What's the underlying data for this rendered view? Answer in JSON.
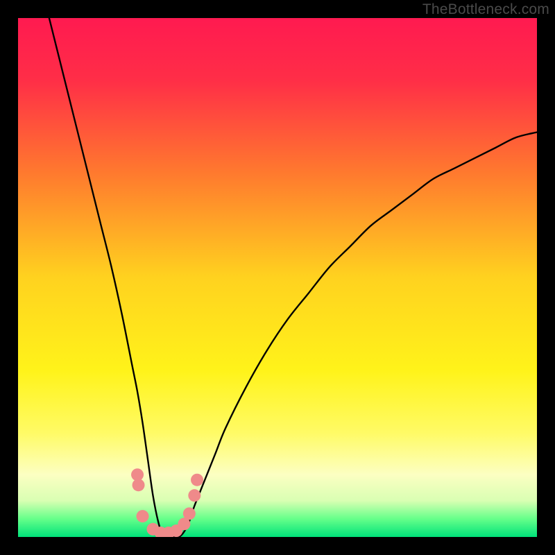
{
  "watermark": "TheBottleneck.com",
  "chart_data": {
    "type": "line",
    "title": "",
    "xlabel": "",
    "ylabel": "",
    "xlim": [
      0,
      100
    ],
    "ylim": [
      0,
      100
    ],
    "background_gradient": {
      "stops": [
        {
          "offset": 0.0,
          "color": "#ff1a50"
        },
        {
          "offset": 0.12,
          "color": "#ff2e47"
        },
        {
          "offset": 0.3,
          "color": "#ff7a2e"
        },
        {
          "offset": 0.5,
          "color": "#ffd21f"
        },
        {
          "offset": 0.68,
          "color": "#fff31a"
        },
        {
          "offset": 0.8,
          "color": "#fffb66"
        },
        {
          "offset": 0.88,
          "color": "#fcffc2"
        },
        {
          "offset": 0.93,
          "color": "#d9ffb3"
        },
        {
          "offset": 0.965,
          "color": "#66ff8a"
        },
        {
          "offset": 1.0,
          "color": "#00e27a"
        }
      ]
    },
    "series": [
      {
        "name": "bottleneck-curve",
        "color": "#000000",
        "x": [
          6,
          8,
          10,
          12,
          14,
          16,
          18,
          20,
          22,
          23,
          24,
          25,
          26,
          27,
          28,
          29,
          30,
          31,
          32,
          33,
          34,
          36,
          38,
          40,
          44,
          48,
          52,
          56,
          60,
          64,
          68,
          72,
          76,
          80,
          84,
          88,
          92,
          96,
          100
        ],
        "y": [
          100,
          92,
          84,
          76,
          68,
          60,
          52,
          43,
          33,
          28,
          22,
          15,
          8,
          3,
          0,
          0,
          0,
          0,
          1,
          3,
          6,
          11,
          16,
          21,
          29,
          36,
          42,
          47,
          52,
          56,
          60,
          63,
          66,
          69,
          71,
          73,
          75,
          77,
          78
        ]
      }
    ],
    "markers": {
      "name": "highlight-dots",
      "color": "#ef8a8a",
      "radius_px": 9,
      "points": [
        {
          "x": 23.0,
          "y": 12
        },
        {
          "x": 23.2,
          "y": 10
        },
        {
          "x": 24.0,
          "y": 4
        },
        {
          "x": 26.0,
          "y": 1.5
        },
        {
          "x": 27.5,
          "y": 0.8
        },
        {
          "x": 29.0,
          "y": 0.8
        },
        {
          "x": 30.5,
          "y": 1.2
        },
        {
          "x": 32.0,
          "y": 2.5
        },
        {
          "x": 33.0,
          "y": 4.5
        },
        {
          "x": 34.0,
          "y": 8.0
        },
        {
          "x": 34.5,
          "y": 11.0
        }
      ]
    }
  }
}
